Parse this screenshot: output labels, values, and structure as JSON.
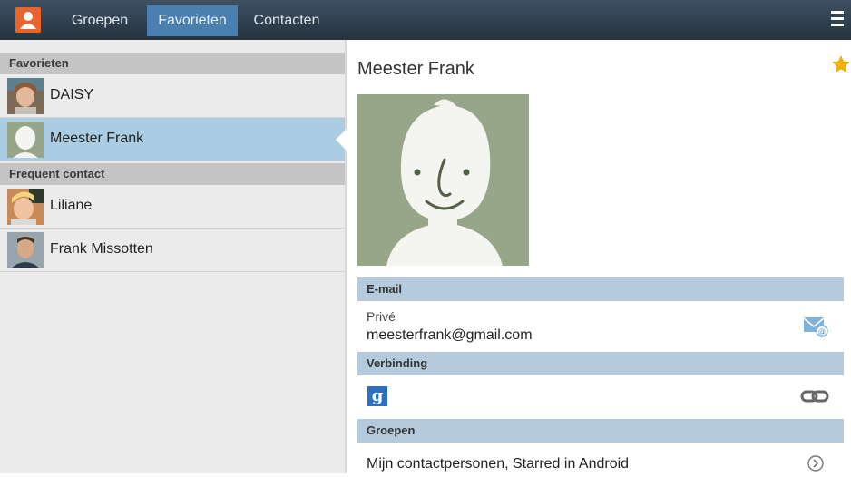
{
  "tabs": [
    {
      "label": "Groepen"
    },
    {
      "label": "Favorieten"
    },
    {
      "label": "Contacten"
    }
  ],
  "sidebar": {
    "favorites_header": "Favorieten",
    "frequent_header": "Frequent contact",
    "favorites": [
      {
        "name": "DAISY"
      },
      {
        "name": "Meester Frank"
      }
    ],
    "frequent": [
      {
        "name": "Liliane"
      },
      {
        "name": "Frank Missotten"
      }
    ]
  },
  "detail": {
    "name": "Meester Frank",
    "email_header": "E-mail",
    "email_type": "Privé",
    "email_value": "meesterfrank@gmail.com",
    "connection_header": "Verbinding",
    "groups_header": "Groepen",
    "groups_value": "Mijn contactpersonen, Starred in Android",
    "google_letter": "g"
  },
  "colors": {
    "accent": "#4a7fb2",
    "selected_row": "#aacde4",
    "section_header": "#b5cadc",
    "star": "#f5b400",
    "app_icon": "#e8642a"
  }
}
